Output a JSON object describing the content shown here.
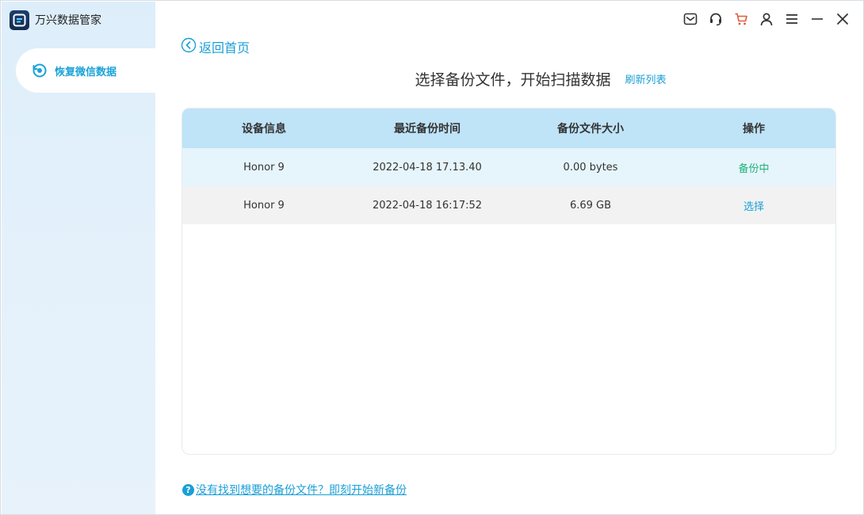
{
  "app": {
    "title": "万兴数据管家",
    "logo_icon": "app-logo-icon",
    "accent_color": "#1a9fd6"
  },
  "sidebar": {
    "items": [
      {
        "label": "恢复微信数据",
        "icon": "restore-icon",
        "active": true
      }
    ]
  },
  "toolbar": {
    "icons": [
      "mail-icon",
      "headset-icon",
      "cart-icon",
      "user-icon",
      "menu-icon",
      "minimize-icon",
      "close-icon"
    ]
  },
  "main": {
    "back_label": "返回首页",
    "heading": "选择备份文件，开始扫描数据",
    "refresh_label": "刷新列表",
    "table": {
      "columns": [
        "设备信息",
        "最近备份时间",
        "备份文件大小",
        "操作"
      ],
      "rows": [
        {
          "device": "Honor 9",
          "time": "2022-04-18 17.13.40",
          "size": "0.00 bytes",
          "action": "备份中",
          "action_color": "#1fb277"
        },
        {
          "device": "Honor 9",
          "time": "2022-04-18 16:17:52",
          "size": "6.69 GB",
          "action": "选择",
          "action_color": "#1a9fd6"
        }
      ]
    },
    "footer_link": "没有找到想要的备份文件？即刻开始新备份",
    "help_icon_glyph": "?"
  }
}
